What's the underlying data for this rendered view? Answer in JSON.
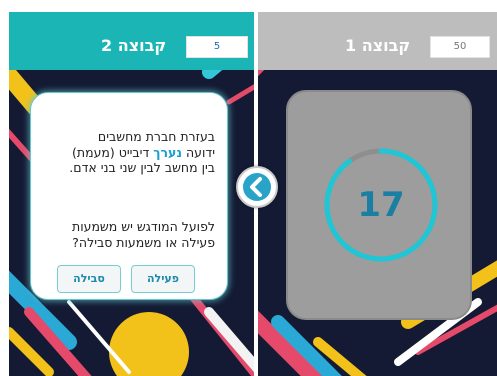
{
  "team2": {
    "name": "קבוצה 2",
    "score": "5",
    "question_line1": "בעזרת חברת מחשבים",
    "question_line2_a": "ידועה ",
    "question_highlight": "נערך",
    "question_line2_b": " דיבייט (מעמת)",
    "question_line3": "בין מחשב לבין שני בני אדם.",
    "question2_line1": "לפועל המודגש יש משמעות",
    "question2_line2": "פעילה או משמעות סבילה?",
    "btn_active": "פעילה",
    "btn_passive": "סבילה"
  },
  "team1": {
    "name": "קבוצה 1",
    "score": "50",
    "timer": "17",
    "timer_fraction": 0.9
  },
  "colors": {
    "accent_teal": "#1cb5b5",
    "inactive_gray": "#bdbdbd",
    "highlight": "#1a9fd0",
    "timer_ring": "#1fc7d6"
  },
  "icons": {
    "swap": "chevron-left-icon"
  }
}
